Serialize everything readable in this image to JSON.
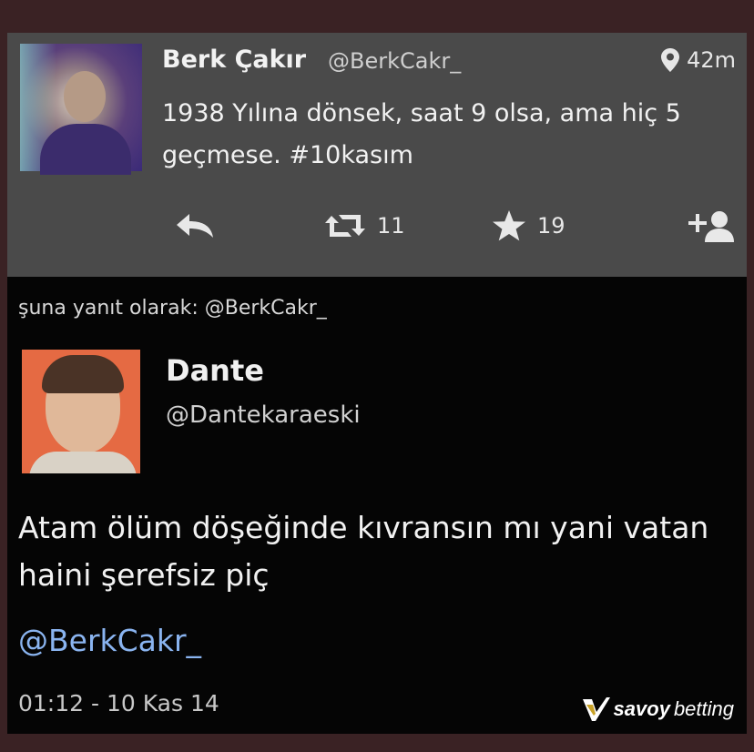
{
  "original_tweet": {
    "author_name": "Berk Çakır",
    "author_handle": "@BerkCakr_",
    "time_ago": "42m",
    "text": "1938 Yılına dönsek, saat 9 olsa, ama hiç 5 geçmese. #10kasım",
    "actions": {
      "reply_icon": "reply-arrow-icon",
      "retweet_icon": "retweet-icon",
      "retweet_count": "11",
      "favorite_icon": "star-icon",
      "favorite_count": "19",
      "follow_icon": "add-user-icon"
    },
    "location_icon": "location-pin-icon"
  },
  "reply": {
    "context": "şuna yanıt olarak: @BerkCakr_",
    "author_name": "Dante",
    "author_handle": "@Dantekaraeski",
    "text": "Atam ölüm döşeğinde kıvransın mı yani vatan haini şerefsiz piç",
    "mention": "@BerkCakr_",
    "timestamp": "01:12 - 10 Kas 14"
  },
  "watermark": {
    "brand_savoy": "savoy",
    "brand_betting": "betting"
  },
  "colors": {
    "background": "#3a2224",
    "card": "#4a4a4a",
    "reply_bg": "#050505",
    "mention": "#8ab4f0",
    "reply_avatar": "#e56a43"
  }
}
